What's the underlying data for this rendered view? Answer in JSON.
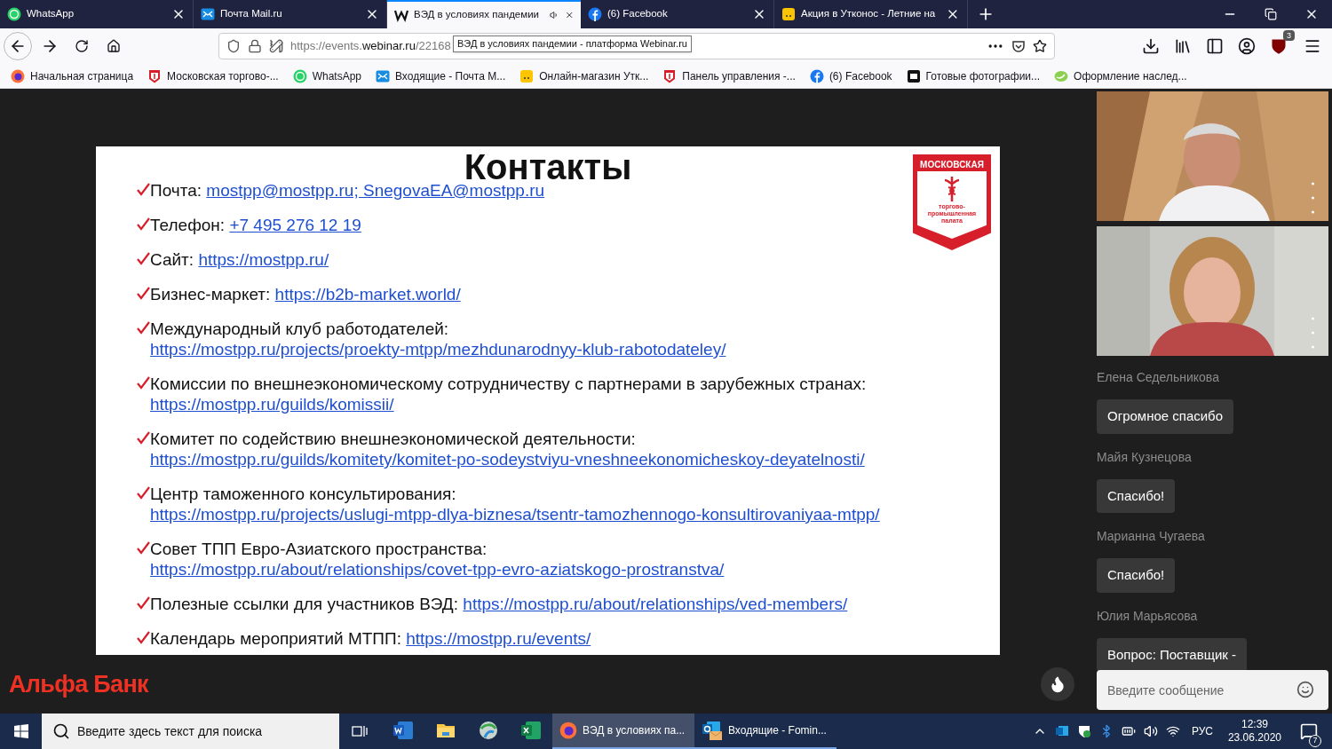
{
  "browser": {
    "tabs": [
      {
        "title": "WhatsApp",
        "selected": false,
        "playing_audio": false
      },
      {
        "title": "Почта Mail.ru",
        "selected": false,
        "playing_audio": false
      },
      {
        "title": "ВЭД в условиях пандемии",
        "selected": true,
        "playing_audio": true
      },
      {
        "title": "(6) Facebook",
        "selected": false,
        "playing_audio": false
      },
      {
        "title": "Акция в Утконос - Летние на",
        "selected": false,
        "playing_audio": false
      }
    ],
    "url": {
      "scheme": "https://events.",
      "host": "webinar.ru",
      "path": "/22168"
    },
    "tooltip": "ВЭД в условиях пандемии - платформа Webinar.ru",
    "extension_badge": "3",
    "bookmarks": [
      {
        "title": "Начальная страница"
      },
      {
        "title": "Московская торгово-..."
      },
      {
        "title": "WhatsApp"
      },
      {
        "title": "Входящие - Почта М..."
      },
      {
        "title": "Онлайн-магазин Утк..."
      },
      {
        "title": "Панель управления -..."
      },
      {
        "title": "(6) Facebook"
      },
      {
        "title": "Готовые фотографии..."
      },
      {
        "title": "Оформление наслед..."
      }
    ]
  },
  "slide": {
    "title": "Контакты",
    "logo": {
      "top": "МОСКОВСКАЯ",
      "bottom": "торгово-промышленная палата"
    },
    "items": [
      {
        "label": "Почта: ",
        "link": "mostpp@mostpp.ru;  SnegovaEA@mostpp.ru"
      },
      {
        "label": "Телефон: ",
        "link": "+7 495 276 12 19"
      },
      {
        "label": "Сайт: ",
        "link": "https://mostpp.ru/"
      },
      {
        "label": "Бизнес-маркет: ",
        "link": "https://b2b-market.world/"
      },
      {
        "label": "Международный клуб работодателей: ",
        "link": "https://mostpp.ru/projects/proekty-mtpp/mezhdunarodnyy-klub-rabotodateley/"
      },
      {
        "label": "Комиссии по внешнеэкономическому сотрудничеству с партнерами в зарубежных странах: ",
        "link": "https://mostpp.ru/guilds/komissii/"
      },
      {
        "label": "Комитет по содействию внешнеэкономической деятельности: ",
        "link": "https://mostpp.ru/guilds/komitety/komitet-po-sodeystviyu-vneshneekonomicheskoy-deyatelnosti/"
      },
      {
        "label": "Центр таможенного консультирования: ",
        "link": "https://mostpp.ru/projects/uslugi-mtpp-dlya-biznesa/tsentr-tamozhennogo-konsultirovaniyaa-mtpp/"
      },
      {
        "label": "Совет ТПП Евро-Азиатского пространства: ",
        "link": "https://mostpp.ru/about/relationships/covet-tpp-evro-aziatskogo-prostranstva/"
      },
      {
        "label": "Полезные ссылки для участников ВЭД: ",
        "link": "https://mostpp.ru/about/relationships/ved-members/"
      },
      {
        "label": "Календарь мероприятий МТПП: ",
        "link": "https://mostpp.ru/events/"
      }
    ]
  },
  "chat": {
    "messages": [
      {
        "author": "Елена Седельникова",
        "text": "Огромное спасибо"
      },
      {
        "author": "Майя Кузнецова",
        "text": "Спасибо!"
      },
      {
        "author": "Марианна Чугаева",
        "text": "Спасибо!"
      },
      {
        "author": "Юлия Марьясова",
        "text": "Вопрос: Поставщик -"
      }
    ],
    "input": {
      "placeholder": "Введите сообщение"
    }
  },
  "sponsor": "Альфа Банк",
  "taskbar": {
    "search_placeholder": "Введите здесь текст для поиска",
    "apps": [
      {
        "kind": "icon",
        "selected": false
      },
      {
        "kind": "icon",
        "selected": false
      },
      {
        "kind": "icon",
        "selected": false
      },
      {
        "kind": "icon",
        "selected": false
      },
      {
        "kind": "window",
        "title": "ВЭД в условиях па...",
        "selected": true
      },
      {
        "kind": "window",
        "title": "Входящие - Fomin...",
        "selected": false
      }
    ],
    "language": "РУС",
    "time": "12:39",
    "date": "23.06.2020",
    "notifications": "7"
  }
}
